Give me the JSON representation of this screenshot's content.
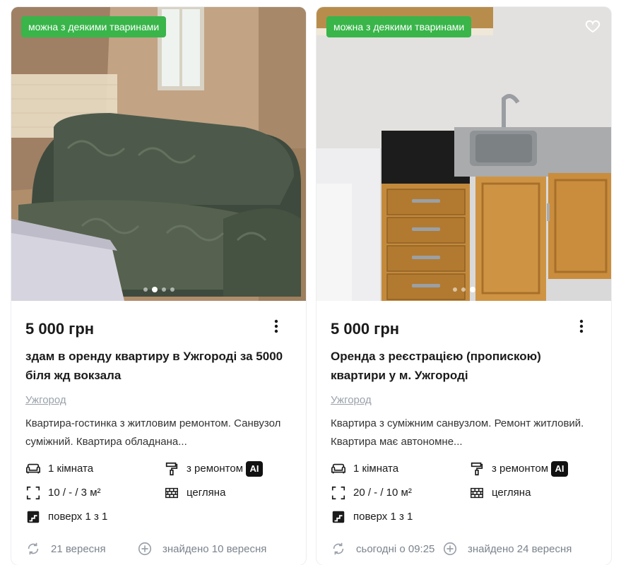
{
  "listings": [
    {
      "badge": "можна з деякими тваринами",
      "price": "5 000 грн",
      "title": "здам в оренду квартиру в Ужгороді за 5000 біля жд вокзала",
      "location": "Ужгород",
      "description": "Квартира-гостинка з житловим ремонтом. Санвузол суміжний. Квартира обладнана...",
      "rooms": "1 кімната",
      "repair": "з ремонтом",
      "ai_label": "AI",
      "area": "10 / - / 3 м²",
      "material": "цегляна",
      "floor": "поверх 1 з 1",
      "updated": "21 вересня",
      "found": "знайдено 10 вересня",
      "photo_count": 4,
      "photo_active": 2,
      "favorite_icon": false
    },
    {
      "badge": "можна з деякими тваринами",
      "price": "5 000 грн",
      "title": "Оренда з реєстрацією (пропискою) квартири у м. Ужгороді",
      "location": "Ужгород",
      "description": "Квартира з суміжним санвузлом. Ремонт житловий. Квартира має автономне...",
      "rooms": "1 кімната",
      "repair": "з ремонтом",
      "ai_label": "AI",
      "area": "20 / - / 10 м²",
      "material": "цегляна",
      "floor": "поверх 1 з 1",
      "updated": "сьогодні о 09:25",
      "found": "знайдено 24 вересня",
      "photo_count": 3,
      "photo_active": 3,
      "favorite_icon": true
    }
  ],
  "colors": {
    "badge": "#39b54a",
    "muted": "#9aa1aa"
  }
}
